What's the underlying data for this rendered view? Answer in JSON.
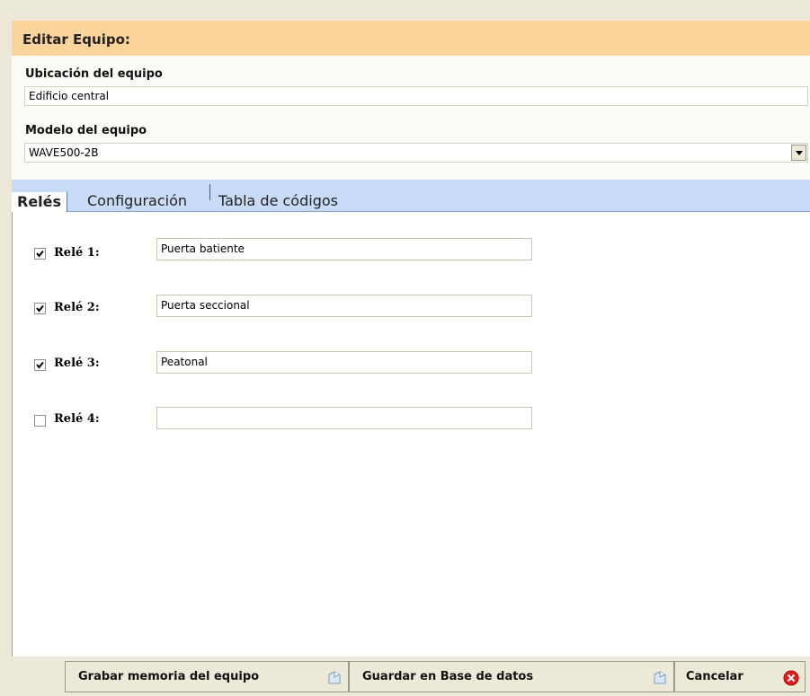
{
  "header": {
    "title": "Editar Equipo:"
  },
  "location": {
    "label": "Ubicación del equipo",
    "value": "Edificio central"
  },
  "model": {
    "label": "Modelo del equipo",
    "value": "WAVE500-2B"
  },
  "tabs": [
    {
      "label": "Relés",
      "active": true
    },
    {
      "label": "Configuración",
      "active": false
    },
    {
      "label": "Tabla de códigos",
      "active": false
    }
  ],
  "relays": [
    {
      "label": "Relé 1:",
      "checked": true,
      "value": "Puerta batiente"
    },
    {
      "label": "Relé 2:",
      "checked": true,
      "value": "Puerta seccional"
    },
    {
      "label": "Relé 3:",
      "checked": true,
      "value": "Peatonal"
    },
    {
      "label": "Relé 4:",
      "checked": false,
      "value": ""
    }
  ],
  "footer": {
    "write_memory": "Grabar memoria del equipo",
    "save_db": "Guardar en Base de datos",
    "cancel": "Cancelar"
  },
  "colors": {
    "header_bg": "#fbd39b",
    "tab_bar_bg": "#c9dcf7",
    "cancel_icon": "#e02020"
  }
}
